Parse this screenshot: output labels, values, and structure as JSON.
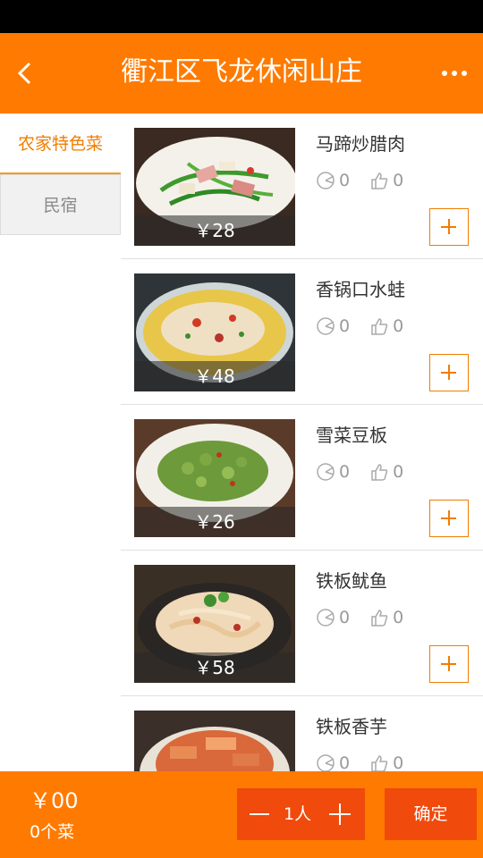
{
  "header": {
    "title": "衢江区飞龙休闲山庄",
    "back_icon": "chevron-left-icon",
    "more_icon": "more-dots-icon"
  },
  "sidebar": {
    "categories": [
      {
        "label": "农家特色菜",
        "active": true
      },
      {
        "label": "民宿",
        "active": false
      }
    ]
  },
  "dishes": [
    {
      "name": "马蹄炒腊肉",
      "price": "￥28",
      "views": "0",
      "likes": "0"
    },
    {
      "name": "香锅口水蛙",
      "price": "￥48",
      "views": "0",
      "likes": "0"
    },
    {
      "name": "雪菜豆板",
      "price": "￥26",
      "views": "0",
      "likes": "0"
    },
    {
      "name": "铁板鱿鱼",
      "price": "￥58",
      "views": "0",
      "likes": "0"
    },
    {
      "name": "铁板香芋",
      "price": "",
      "views": "0",
      "likes": "0"
    }
  ],
  "footer": {
    "total": "￥00",
    "count": "0个菜",
    "people": "1人",
    "confirm": "确定"
  },
  "colors": {
    "primary": "#ff7a00",
    "accent_dark": "#f04a0c",
    "category_active": "#f07d00"
  }
}
